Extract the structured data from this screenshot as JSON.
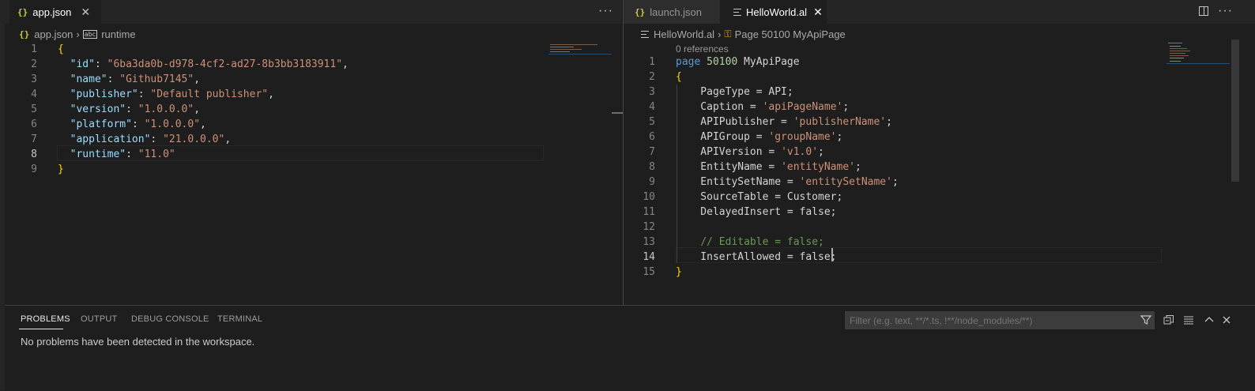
{
  "left_editor": {
    "tab": {
      "icon": "json-braces-icon",
      "label": "app.json"
    },
    "breadcrumb": {
      "file": "app.json",
      "symbol": "runtime"
    },
    "lines": [
      {
        "n": "1",
        "tokens": [
          {
            "t": "{",
            "c": "brace"
          }
        ]
      },
      {
        "n": "2",
        "tokens": [
          {
            "t": "  ",
            "c": "punc"
          },
          {
            "t": "\"id\"",
            "c": "key"
          },
          {
            "t": ": ",
            "c": "punc"
          },
          {
            "t": "\"6ba3da0b-d978-4cf2-ad27-8b3bb3183911\"",
            "c": "str"
          },
          {
            "t": ",",
            "c": "punc"
          }
        ]
      },
      {
        "n": "3",
        "tokens": [
          {
            "t": "  ",
            "c": "punc"
          },
          {
            "t": "\"name\"",
            "c": "key"
          },
          {
            "t": ": ",
            "c": "punc"
          },
          {
            "t": "\"Github7145\"",
            "c": "str"
          },
          {
            "t": ",",
            "c": "punc"
          }
        ]
      },
      {
        "n": "4",
        "tokens": [
          {
            "t": "  ",
            "c": "punc"
          },
          {
            "t": "\"publisher\"",
            "c": "key"
          },
          {
            "t": ": ",
            "c": "punc"
          },
          {
            "t": "\"Default publisher\"",
            "c": "str"
          },
          {
            "t": ",",
            "c": "punc"
          }
        ]
      },
      {
        "n": "5",
        "tokens": [
          {
            "t": "  ",
            "c": "punc"
          },
          {
            "t": "\"version\"",
            "c": "key"
          },
          {
            "t": ": ",
            "c": "punc"
          },
          {
            "t": "\"1.0.0.0\"",
            "c": "str"
          },
          {
            "t": ",",
            "c": "punc"
          }
        ]
      },
      {
        "n": "6",
        "tokens": [
          {
            "t": "  ",
            "c": "punc"
          },
          {
            "t": "\"platform\"",
            "c": "key"
          },
          {
            "t": ": ",
            "c": "punc"
          },
          {
            "t": "\"1.0.0.0\"",
            "c": "str"
          },
          {
            "t": ",",
            "c": "punc"
          }
        ]
      },
      {
        "n": "7",
        "tokens": [
          {
            "t": "  ",
            "c": "punc"
          },
          {
            "t": "\"application\"",
            "c": "key"
          },
          {
            "t": ": ",
            "c": "punc"
          },
          {
            "t": "\"21.0.0.0\"",
            "c": "str"
          },
          {
            "t": ",",
            "c": "punc"
          }
        ]
      },
      {
        "n": "8",
        "tokens": [
          {
            "t": "  ",
            "c": "punc"
          },
          {
            "t": "\"runtime\"",
            "c": "key"
          },
          {
            "t": ": ",
            "c": "punc"
          },
          {
            "t": "\"11.0\"",
            "c": "str"
          }
        ]
      },
      {
        "n": "9",
        "tokens": [
          {
            "t": "}",
            "c": "brace"
          }
        ]
      }
    ],
    "current_line": "8"
  },
  "right_editor": {
    "tabs": [
      {
        "icon": "json-braces-icon",
        "label": "launch.json"
      },
      {
        "icon": "al-file-icon",
        "label": "HelloWorld.al"
      }
    ],
    "breadcrumb": {
      "file": "HelloWorld.al",
      "symbol": "Page 50100 MyApiPage"
    },
    "codelens": "0 references",
    "lines": [
      {
        "n": "1",
        "tokens": [
          {
            "t": "page",
            "c": "kw"
          },
          {
            "t": " ",
            "c": "plain"
          },
          {
            "t": "50100",
            "c": "num"
          },
          {
            "t": " MyApiPage",
            "c": "plain"
          }
        ]
      },
      {
        "n": "2",
        "tokens": [
          {
            "t": "{",
            "c": "brace"
          }
        ]
      },
      {
        "n": "3",
        "tokens": [
          {
            "t": "    PageType = API;",
            "c": "plain"
          }
        ]
      },
      {
        "n": "4",
        "tokens": [
          {
            "t": "    Caption = ",
            "c": "plain"
          },
          {
            "t": "'apiPageName'",
            "c": "str"
          },
          {
            "t": ";",
            "c": "plain"
          }
        ]
      },
      {
        "n": "5",
        "tokens": [
          {
            "t": "    APIPublisher = ",
            "c": "plain"
          },
          {
            "t": "'publisherName'",
            "c": "str"
          },
          {
            "t": ";",
            "c": "plain"
          }
        ]
      },
      {
        "n": "6",
        "tokens": [
          {
            "t": "    APIGroup = ",
            "c": "plain"
          },
          {
            "t": "'groupName'",
            "c": "str"
          },
          {
            "t": ";",
            "c": "plain"
          }
        ]
      },
      {
        "n": "7",
        "tokens": [
          {
            "t": "    APIVersion = ",
            "c": "plain"
          },
          {
            "t": "'v1.0'",
            "c": "str"
          },
          {
            "t": ";",
            "c": "plain"
          }
        ]
      },
      {
        "n": "8",
        "tokens": [
          {
            "t": "    EntityName = ",
            "c": "plain"
          },
          {
            "t": "'entityName'",
            "c": "str"
          },
          {
            "t": ";",
            "c": "plain"
          }
        ]
      },
      {
        "n": "9",
        "tokens": [
          {
            "t": "    EntitySetName = ",
            "c": "plain"
          },
          {
            "t": "'entitySetName'",
            "c": "str"
          },
          {
            "t": ";",
            "c": "plain"
          }
        ]
      },
      {
        "n": "10",
        "tokens": [
          {
            "t": "    SourceTable = Customer;",
            "c": "plain"
          }
        ]
      },
      {
        "n": "11",
        "tokens": [
          {
            "t": "    DelayedInsert = false;",
            "c": "plain"
          }
        ]
      },
      {
        "n": "12",
        "tokens": []
      },
      {
        "n": "13",
        "tokens": [
          {
            "t": "    ",
            "c": "plain"
          },
          {
            "t": "// Editable = false;",
            "c": "cmt"
          }
        ]
      },
      {
        "n": "14",
        "tokens": [
          {
            "t": "    InsertAllowed = false;",
            "c": "plain"
          }
        ]
      },
      {
        "n": "15",
        "tokens": [
          {
            "t": "}",
            "c": "brace"
          }
        ]
      }
    ],
    "current_line": "14"
  },
  "panel": {
    "tabs": [
      "PROBLEMS",
      "OUTPUT",
      "DEBUG CONSOLE",
      "TERMINAL"
    ],
    "active_tab": "PROBLEMS",
    "filter_placeholder": "Filter (e.g. text, **/*.ts, !**/node_modules/**)",
    "message": "No problems have been detected in the workspace."
  },
  "icons": {
    "more": "ellipsis-icon",
    "close": "close-icon",
    "split": "split-editor-icon",
    "filter": "funnel-icon",
    "collapse": "collapse-all-icon",
    "wrap": "word-wrap-icon",
    "maximize": "chevron-up-icon"
  },
  "colors": {
    "background": "#1e1e1e",
    "tab_inactive": "#2d2d2d",
    "json_icon": "#cbcb41",
    "symbol_icon": "#ee9d28",
    "panel_active_underline": "#e7e7e7"
  }
}
